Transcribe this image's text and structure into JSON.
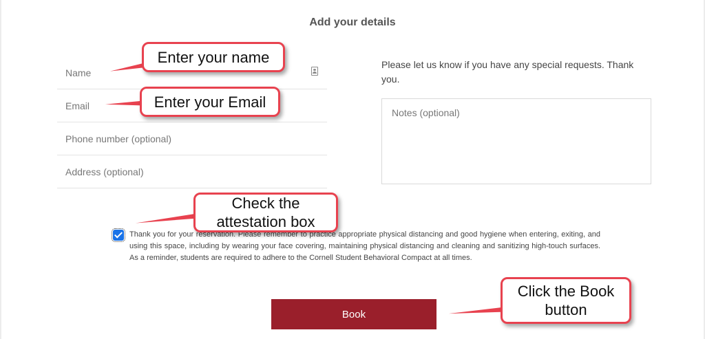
{
  "form": {
    "title": "Add your details",
    "name_placeholder": "Name",
    "email_placeholder": "Email",
    "phone_placeholder": "Phone number (optional)",
    "address_placeholder": "Address (optional)",
    "requests_text": "Please let us know if you have any special requests. Thank you.",
    "notes_placeholder": "Notes (optional)",
    "attestation_checked": true,
    "attestation_text": "Thank you for your reservation. Please remember to practice appropriate physical distancing and good hygiene when entering, exiting, and using this space, including by wearing your face covering, maintaining physical distancing and cleaning and sanitizing high-touch surfaces. As a reminder, students are required to adhere to the Cornell Student Behavioral Compact at all times.",
    "book_label": "Book"
  },
  "callouts": {
    "name": "Enter your name",
    "email": "Enter your Email",
    "attest_line1": "Check the",
    "attest_line2": "attestation box",
    "book_line1": "Click the Book",
    "book_line2": "button"
  },
  "colors": {
    "book_button": "#9a1f2b",
    "callout_border": "#e8424f",
    "checkbox": "#1a73e8"
  }
}
